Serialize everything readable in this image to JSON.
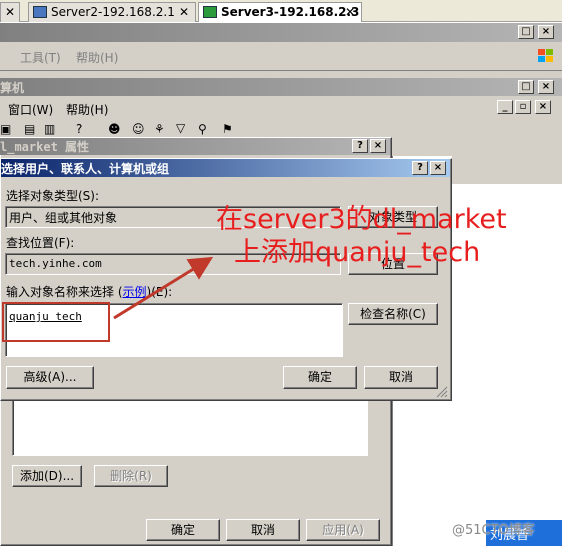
{
  "tabs": [
    {
      "label": "Server2-192.168.2.1",
      "close": "✕"
    },
    {
      "label": "Server3-192.168.2.3",
      "close": "✕"
    }
  ],
  "mmc": {
    "menu": {
      "tools": "工具(T)",
      "help": "帮助(H)"
    },
    "inner_title": "算机",
    "inner_menu": {
      "window": "窗口(W)",
      "help": "帮助(H)"
    }
  },
  "props": {
    "title": "l_market 属性",
    "buttons": {
      "add": "添加(D)...",
      "remove": "删除(R)",
      "ok": "确定",
      "cancel": "取消",
      "apply": "应用(A)"
    }
  },
  "dialog": {
    "title": "选择用户、联系人、计算机或组",
    "object_type_label": "选择对象类型(S):",
    "object_type_value": "用户、组或其他对象",
    "object_types_button": "对象类型",
    "location_label": "查找位置(F):",
    "location_value": "tech.yinhe.com",
    "location_button": "位置",
    "enter_label_prefix": "输入对象名称来选择 (",
    "enter_label_link": "示例",
    "enter_label_suffix": ")(E):",
    "enter_value": "quanju tech",
    "check_names_button": "检查名称(C)",
    "advanced_button": "高级(A)...",
    "ok_button": "确定",
    "cancel_button": "取消"
  },
  "annotation": {
    "line1": "在server3的dl_market",
    "line2": "上添加quanju_tech",
    "color": "#e81e1e"
  },
  "watermark": {
    "text": "@51CTO博客",
    "badge": "刘晨普"
  }
}
